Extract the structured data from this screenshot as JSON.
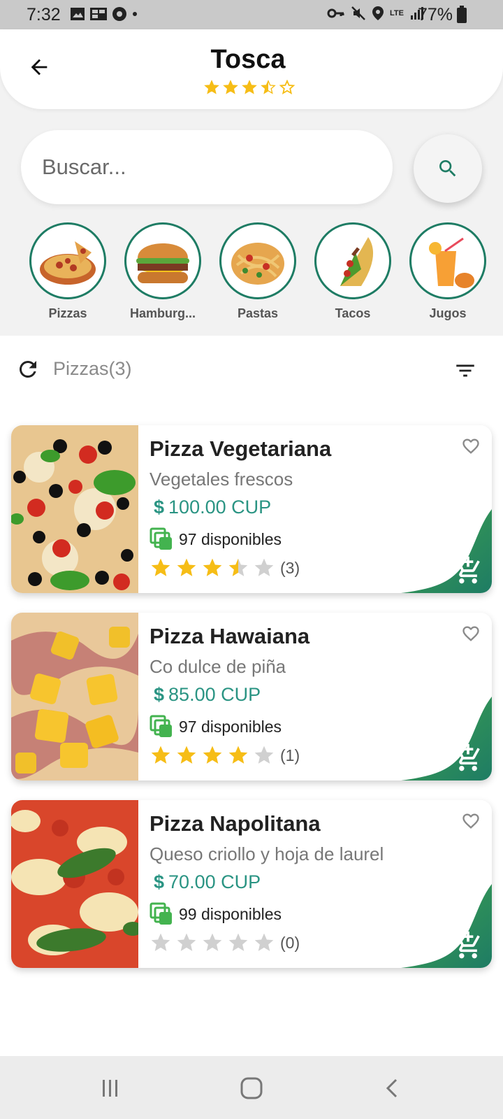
{
  "status_bar": {
    "time": "7:32",
    "battery": "77%",
    "network": "LTE"
  },
  "header": {
    "title": "Tosca",
    "rating": 3.5,
    "max_rating": 5,
    "back_icon": "arrow-left-icon"
  },
  "search": {
    "placeholder": "Buscar...",
    "value": "",
    "button_icon": "search-icon"
  },
  "categories": [
    {
      "label": "Pizzas",
      "icon": "pizza-image"
    },
    {
      "label": "Hamburg...",
      "icon": "hamburger-image"
    },
    {
      "label": "Pastas",
      "icon": "pasta-image"
    },
    {
      "label": "Tacos",
      "icon": "taco-image"
    },
    {
      "label": "Jugos",
      "icon": "juice-image"
    }
  ],
  "list": {
    "title": "Pizzas(3)",
    "refresh_icon": "refresh-icon",
    "filter_icon": "filter-icon"
  },
  "products": [
    {
      "name": "Pizza Vegetariana",
      "description": "Vegetales frescos",
      "currency_symbol": "$",
      "price": "100.00 CUP",
      "stock": "97 disponibles",
      "rating": 3.5,
      "reviews": "(3)"
    },
    {
      "name": "Pizza Hawaiana",
      "description": "Co dulce de piña",
      "currency_symbol": "$",
      "price": "85.00 CUP",
      "stock": "97 disponibles",
      "rating": 4,
      "reviews": "(1)"
    },
    {
      "name": "Pizza Napolitana",
      "description": "Queso criollo y hoja de laurel",
      "currency_symbol": "$",
      "price": "70.00 CUP",
      "stock": "99 disponibles",
      "rating": 0,
      "reviews": "(0)"
    }
  ],
  "colors": {
    "accent": "#1e7c64",
    "price": "#2a9483",
    "star": "#f6bd16",
    "star_empty": "#d0d0d0",
    "stock_icon": "#43b34f"
  },
  "nav": {
    "recents_icon": "recents-icon",
    "home_icon": "home-icon",
    "back_icon": "back-chevron-icon"
  }
}
